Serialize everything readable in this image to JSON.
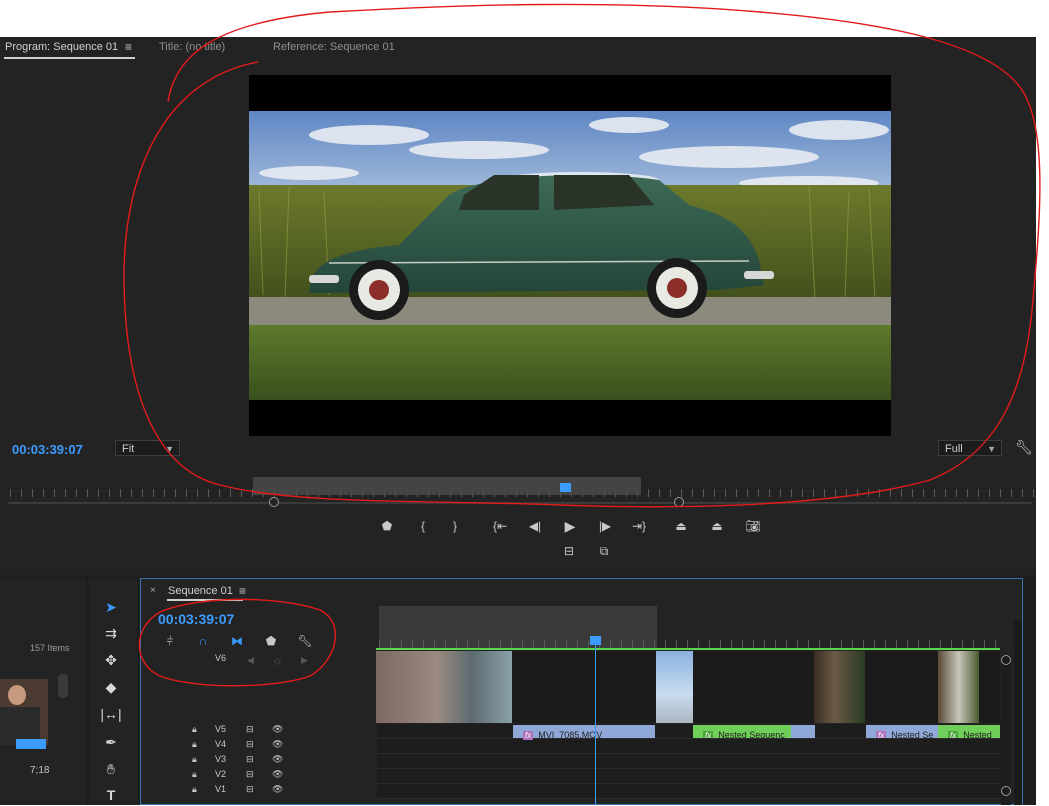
{
  "program_monitor": {
    "tabs": [
      "Program: Sequence 01",
      "Title: (no title)",
      "Reference: Sequence 01"
    ],
    "menu_icon": "hamburger-menu-icon",
    "timecode": "00:03:39:07",
    "fit_dropdown": "Fit",
    "quality_dropdown": "Full",
    "settings_icon": "wrench-icon",
    "transport": {
      "row1": [
        "add-marker-icon",
        "mark-in-icon",
        "mark-out-icon",
        "go-to-in-icon",
        "step-back-icon",
        "play-icon",
        "step-forward-icon",
        "go-to-out-icon",
        "lift-icon",
        "extract-icon",
        "export-frame-icon"
      ],
      "row2": [
        "insert-icon",
        "overwrite-icon"
      ]
    }
  },
  "project_panel": {
    "items_count": "157 Items",
    "thumb_time": "7;18"
  },
  "tools": [
    "selection-tool",
    "track-select-tool",
    "ripple-edit-tool",
    "razor-tool",
    "slip-tool",
    "pen-tool",
    "hand-tool",
    "type-tool"
  ],
  "sequence": {
    "tab_title": "Sequence 01",
    "close": "×",
    "menu": "≡",
    "timecode": "00:03:39:07",
    "v6_label": "V6",
    "tracks": [
      "V5",
      "V4",
      "V3",
      "V2",
      "V1"
    ],
    "clips": [
      {
        "label": "MVI_7085.MOV",
        "color": "#8fa8d8"
      },
      {
        "label": "Nested Sequenc",
        "color": "#6fcf5a"
      },
      {
        "label": "Nested Se",
        "color": "#8fa8d8"
      },
      {
        "label": "Nested",
        "color": "#6fcf5a"
      }
    ]
  },
  "colors": {
    "accent_blue": "#3c9bff",
    "annotation_red": "#e31b1b",
    "panel_bg": "#232323"
  }
}
